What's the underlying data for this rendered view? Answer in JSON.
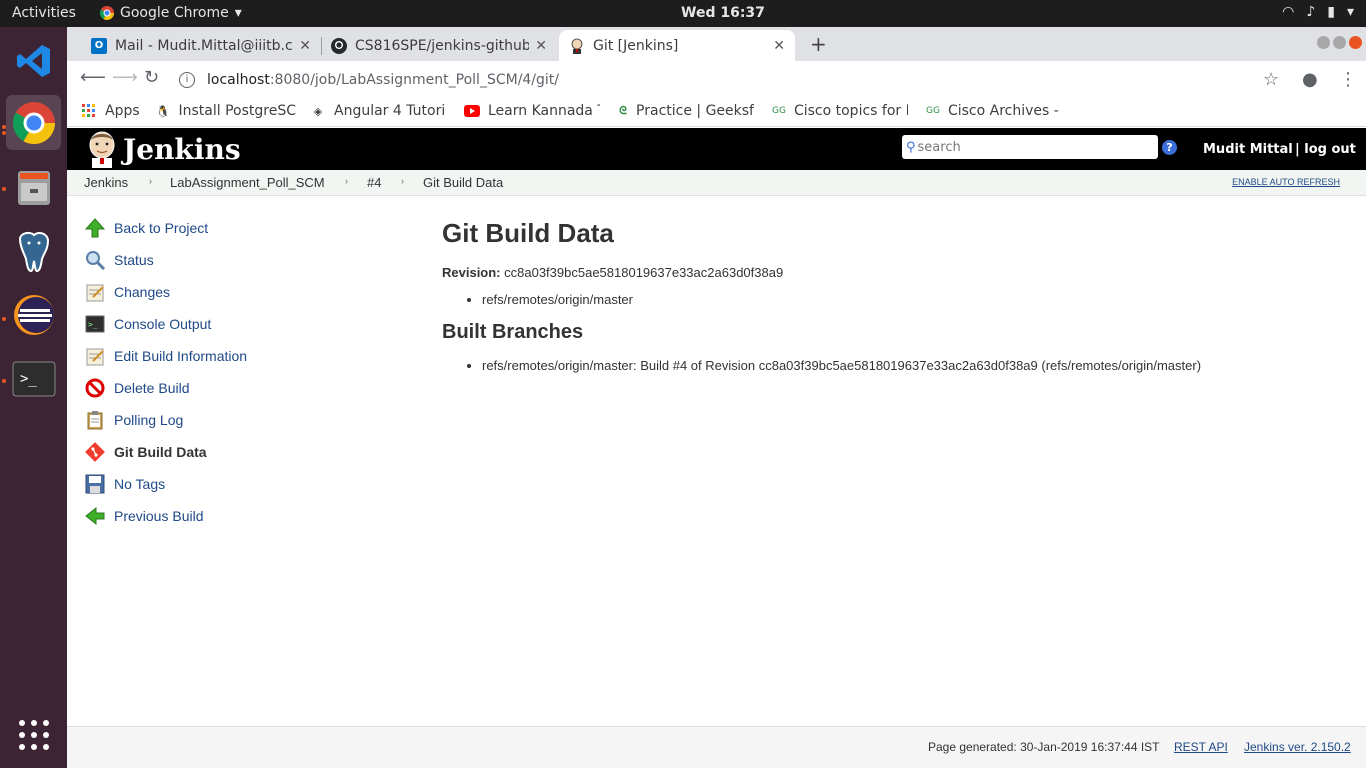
{
  "os": {
    "activities": "Activities",
    "app_menu": "Google Chrome",
    "clock": "Wed 16:37"
  },
  "browser": {
    "tabs": [
      {
        "title": "Mail - Mudit.Mittal@iiitb.c"
      },
      {
        "title": "CS816SPE/jenkins-github"
      },
      {
        "title": "Git [Jenkins]"
      }
    ],
    "url_host": "localhost",
    "url_path": ":8080/job/LabAssignment_Poll_SCM/4/git/",
    "bookmarks": [
      {
        "label": "Apps"
      },
      {
        "label": "Install PostgreSC"
      },
      {
        "label": "Angular 4 Tutori"
      },
      {
        "label": "Learn Kannada T"
      },
      {
        "label": "Practice | Geeksf"
      },
      {
        "label": "Cisco topics for I"
      },
      {
        "label": "Cisco Archives - C"
      }
    ]
  },
  "jenkins": {
    "logo_text": "Jenkins",
    "search_placeholder": "search",
    "help": "?",
    "user": "Mudit Mittal",
    "logout": "| log out",
    "breadcrumbs": [
      "Jenkins",
      "LabAssignment_Poll_SCM",
      "#4",
      "Git Build Data"
    ],
    "auto_refresh": "ENABLE AUTO REFRESH",
    "tasks": [
      {
        "label": "Back to Project",
        "icon": "up-arrow-icon"
      },
      {
        "label": "Status",
        "icon": "magnifier-icon"
      },
      {
        "label": "Changes",
        "icon": "notepad-icon"
      },
      {
        "label": "Console Output",
        "icon": "terminal-icon"
      },
      {
        "label": "Edit Build Information",
        "icon": "notepad-icon"
      },
      {
        "label": "Delete Build",
        "icon": "no-entry-icon"
      },
      {
        "label": "Polling Log",
        "icon": "clipboard-icon"
      },
      {
        "label": "Git Build Data",
        "icon": "git-icon"
      },
      {
        "label": "No Tags",
        "icon": "floppy-icon"
      },
      {
        "label": "Previous Build",
        "icon": "left-arrow-icon"
      }
    ],
    "main": {
      "title": "Git Build Data",
      "revision_label": "Revision:",
      "revision_value": "cc8a03f39bc5ae5818019637e33ac2a63d0f38a9",
      "revision_refs": [
        "refs/remotes/origin/master"
      ],
      "built_branches_title": "Built Branches",
      "built_branches": [
        "refs/remotes/origin/master: Build #4 of Revision cc8a03f39bc5ae5818019637e33ac2a63d0f38a9 (refs/remotes/origin/master)"
      ]
    },
    "footer": {
      "generated": "Page generated: 30-Jan-2019 16:37:44 IST",
      "rest_api": "REST API",
      "version": "Jenkins ver. 2.150.2"
    }
  }
}
